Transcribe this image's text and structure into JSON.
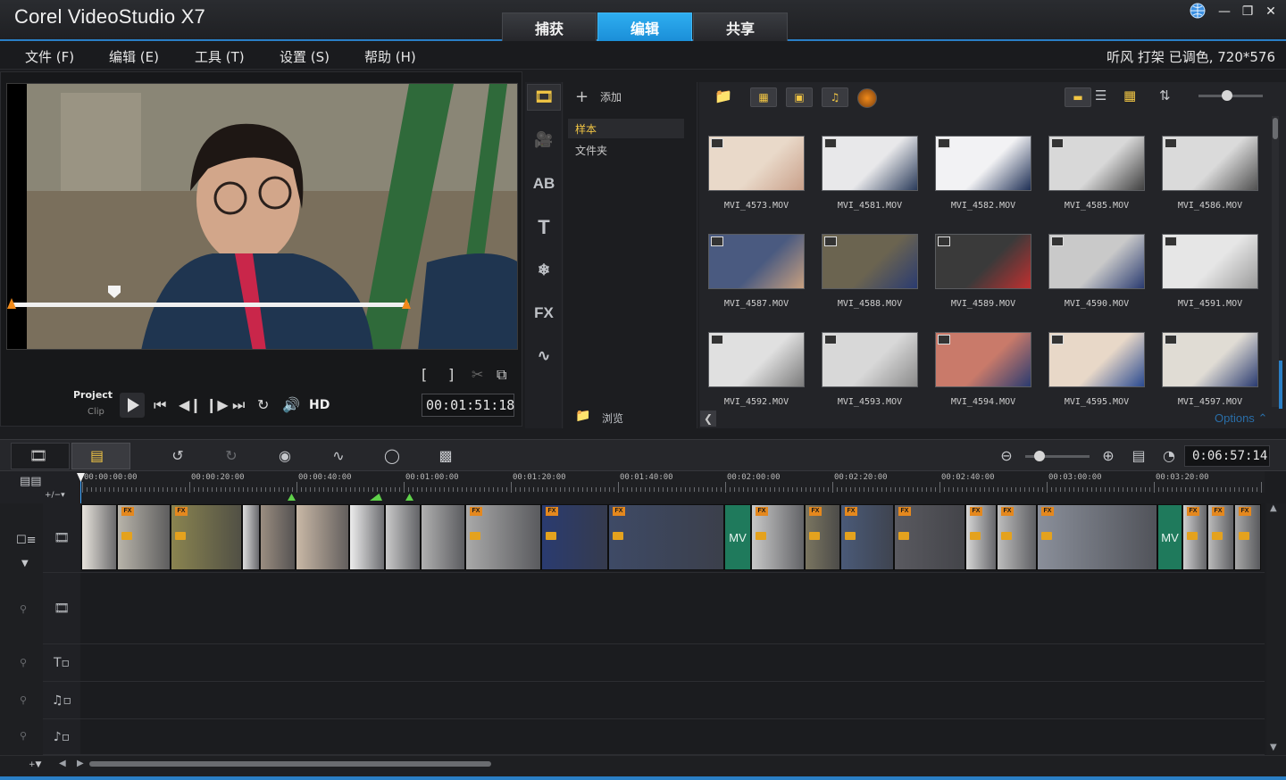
{
  "app": {
    "title": "Corel VideoStudio X7"
  },
  "mode_tabs": [
    {
      "label": "捕获"
    },
    {
      "label": "编辑"
    },
    {
      "label": "共享"
    }
  ],
  "menu": [
    {
      "label": "文件 (F)"
    },
    {
      "label": "编辑 (E)"
    },
    {
      "label": "工具 (T)"
    },
    {
      "label": "设置 (S)"
    },
    {
      "label": "帮助 (H)"
    }
  ],
  "project_info": "听风 打架 已调色, 720*576",
  "player": {
    "project_label": "Project",
    "clip_label": "Clip",
    "hd_label": "HD",
    "timecode": "00:01:51:18"
  },
  "library": {
    "add_label": "添加",
    "nav_items": [
      {
        "label": "样本"
      },
      {
        "label": "文件夹"
      }
    ],
    "browse_label": "浏览",
    "options_label": "Options",
    "thumbnails": [
      {
        "name": "MVI_4573.MOV"
      },
      {
        "name": "MVI_4581.MOV"
      },
      {
        "name": "MVI_4582.MOV"
      },
      {
        "name": "MVI_4585.MOV"
      },
      {
        "name": "MVI_4586.MOV"
      },
      {
        "name": "MVI_4587.MOV"
      },
      {
        "name": "MVI_4588.MOV"
      },
      {
        "name": "MVI_4589.MOV"
      },
      {
        "name": "MVI_4590.MOV"
      },
      {
        "name": "MVI_4591.MOV"
      },
      {
        "name": "MVI_4592.MOV"
      },
      {
        "name": "MVI_4593.MOV"
      },
      {
        "name": "MVI_4594.MOV"
      },
      {
        "name": "MVI_4595.MOV"
      },
      {
        "name": "MVI_4597.MOV"
      }
    ]
  },
  "timeline": {
    "duration": "0:06:57:14",
    "ruler_ticks": [
      "00:00:00:00",
      "00:00:20:00",
      "00:00:40:00",
      "00:01:00:00",
      "00:01:20:00",
      "00:01:40:00",
      "00:02:00:00",
      "00:02:20:00",
      "00:02:40:00",
      "00:03:00:00",
      "00:03:20:00"
    ],
    "clips": [
      {
        "label": "MV"
      },
      {
        "label": "MV"
      }
    ]
  },
  "colors": {
    "accent": "#1b8fd8",
    "fx_badge": "#e4881e",
    "transition": "#1f7a5c",
    "scrub_trim": "#f08a1a"
  }
}
